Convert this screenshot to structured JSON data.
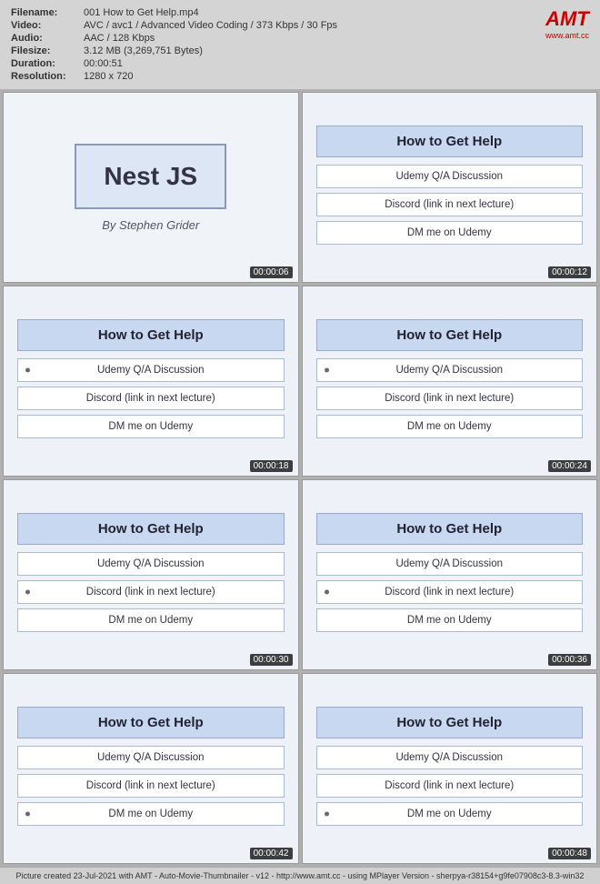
{
  "header": {
    "filename_label": "Filename:",
    "filename_value": "001 How to Get Help.mp4",
    "video_label": "Video:",
    "video_value": "AVC / avc1 / Advanced Video Coding / 373 Kbps / 30 Fps",
    "audio_label": "Audio:",
    "audio_value": "AAC / 128 Kbps",
    "filesize_label": "Filesize:",
    "filesize_value": "3.12 MB (3,269,751 Bytes)",
    "duration_label": "Duration:",
    "duration_value": "00:00:51",
    "resolution_label": "Resolution:",
    "resolution_value": "1280 x 720",
    "logo_text": "AMT",
    "logo_url": "www.amt.cc"
  },
  "nestjs_slide": {
    "title": "Nest JS",
    "subtitle": "By Stephen Grider",
    "timestamp": "00:00:06"
  },
  "help_slides": [
    {
      "heading": "How to Get Help",
      "btn1": "Udemy Q/A Discussion",
      "btn2": "Discord (link in next lecture)",
      "btn3": "DM me on Udemy",
      "timestamp": "00:00:12",
      "btn1_dot": false,
      "btn2_dot": false,
      "btn3_dot": false
    },
    {
      "heading": "How to Get Help",
      "btn1": "Udemy Q/A Discussion",
      "btn2": "Discord (link in next lecture)",
      "btn3": "DM me on Udemy",
      "timestamp": "00:00:18",
      "btn1_dot": true,
      "btn2_dot": false,
      "btn3_dot": false
    },
    {
      "heading": "How to Get Help",
      "btn1": "Udemy Q/A Discussion",
      "btn2": "Discord (link in next lecture)",
      "btn3": "DM me on Udemy",
      "timestamp": "00:00:24",
      "btn1_dot": true,
      "btn2_dot": false,
      "btn3_dot": false
    },
    {
      "heading": "How to Get Help",
      "btn1": "Udemy Q/A Discussion",
      "btn2": "Discord (link in next lecture)",
      "btn3": "DM me on Udemy",
      "timestamp": "00:00:30",
      "btn1_dot": false,
      "btn2_dot": true,
      "btn3_dot": false
    },
    {
      "heading": "How to Get Help",
      "btn1": "Udemy Q/A Discussion",
      "btn2": "Discord (link in next lecture)",
      "btn3": "DM me on Udemy",
      "timestamp": "00:00:36",
      "btn1_dot": false,
      "btn2_dot": true,
      "btn3_dot": false
    },
    {
      "heading": "How to Get Help",
      "btn1": "Udemy Q/A Discussion",
      "btn2": "Discord (link in next lecture)",
      "btn3": "DM me on Udemy",
      "timestamp": "00:00:42",
      "btn1_dot": false,
      "btn2_dot": false,
      "btn3_dot": true
    },
    {
      "heading": "How to Get Help",
      "btn1": "Udemy Q/A Discussion",
      "btn2": "Discord (link in next lecture)",
      "btn3": "DM me on Udemy",
      "timestamp": "00:00:48",
      "btn1_dot": false,
      "btn2_dot": false,
      "btn3_dot": true
    }
  ],
  "footer": {
    "text": "Picture created 23-Jul-2021 with AMT - Auto-Movie-Thumbnailer - v12 - http://www.amt.cc - using MPlayer Version - sherpya-r38154+g9fe07908c3-8.3-win32"
  }
}
